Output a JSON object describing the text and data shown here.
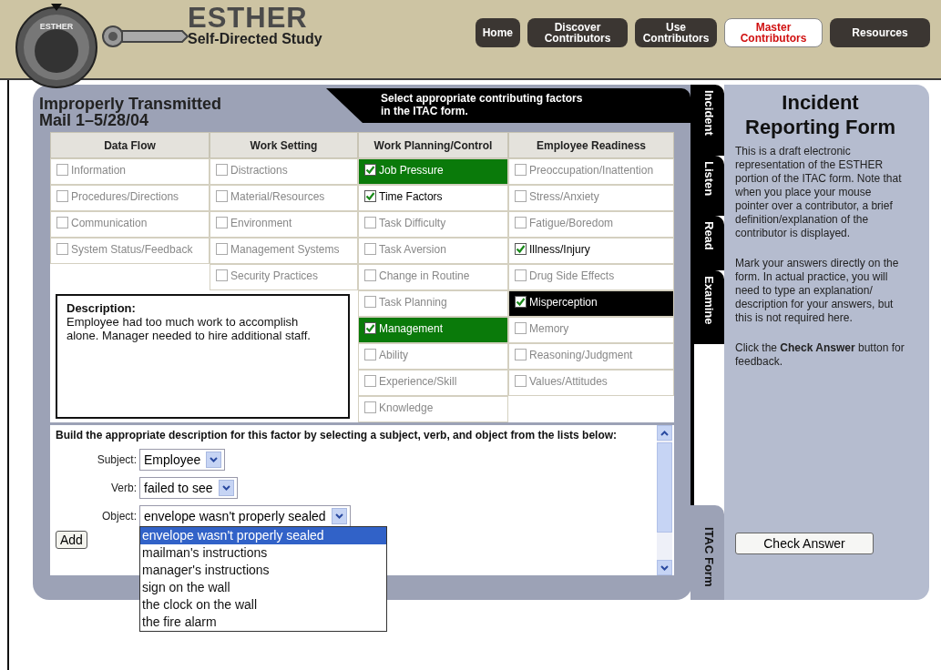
{
  "header": {
    "dial_label": "ESTHER",
    "title": "ESTHER",
    "subtitle": "Self-Directed Study",
    "nav": [
      {
        "label": "Home",
        "selected": false
      },
      {
        "label": "Discover Contributors",
        "selected": false
      },
      {
        "label": "Use Contributors",
        "selected": false
      },
      {
        "label": "Master Contributors",
        "selected": true
      },
      {
        "label": "Resources",
        "selected": false
      }
    ]
  },
  "exercise": {
    "title": "Improperly Transmitted Mail 1–5/28/04",
    "instruction": "Select appropriate contributing factors in the ITAC form.",
    "table": {
      "columns": [
        {
          "heading": "Data Flow",
          "items": [
            {
              "label": "Information",
              "checked": false
            },
            {
              "label": "Procedures/Directions",
              "checked": false
            },
            {
              "label": "Communication",
              "checked": false
            },
            {
              "label": "System Status/Feedback",
              "checked": false
            }
          ]
        },
        {
          "heading": "Work Setting",
          "items": [
            {
              "label": "Distractions",
              "checked": false
            },
            {
              "label": "Material/Resources",
              "checked": false
            },
            {
              "label": "Environment",
              "checked": false
            },
            {
              "label": "Management Systems",
              "checked": false
            },
            {
              "label": "Security Practices",
              "checked": false
            }
          ]
        },
        {
          "heading": "Work Planning/Control",
          "items": [
            {
              "label": "Job Pressure",
              "checked": true,
              "color": "#0a7a0a"
            },
            {
              "label": "Time Factors",
              "checked": true
            },
            {
              "label": "Task Difficulty",
              "checked": false
            },
            {
              "label": "Task Aversion",
              "checked": false
            },
            {
              "label": "Change in Routine",
              "checked": false
            },
            {
              "label": "Task Planning",
              "checked": false
            },
            {
              "label": "Management",
              "checked": true,
              "color": "#0a7a0a"
            },
            {
              "label": "Ability",
              "checked": false
            },
            {
              "label": "Experience/Skill",
              "checked": false
            },
            {
              "label": "Knowledge",
              "checked": false
            }
          ]
        },
        {
          "heading": "Employee Readiness",
          "items": [
            {
              "label": "Preoccupation/Inattention",
              "checked": false
            },
            {
              "label": "Stress/Anxiety",
              "checked": false
            },
            {
              "label": "Fatigue/Boredom",
              "checked": false
            },
            {
              "label": "Illness/Injury",
              "checked": true
            },
            {
              "label": "Drug Side Effects",
              "checked": false
            },
            {
              "label": "Misperception",
              "checked": true,
              "color": "#000000"
            },
            {
              "label": "Memory",
              "checked": false
            },
            {
              "label": "Reasoning/Judgment",
              "checked": false
            },
            {
              "label": "Values/Attitudes",
              "checked": false
            }
          ]
        }
      ]
    },
    "description": {
      "heading": "Description:",
      "text": "Employee had too much work to accomplish alone. Manager needed to hire additional staff."
    },
    "builder": {
      "instruction": "Build the appropriate description for this factor by selecting a subject, verb, and object from the lists below:",
      "fields": [
        {
          "label": "Subject:",
          "value": "Employee"
        },
        {
          "label": "Verb:",
          "value": "failed to see"
        },
        {
          "label": "Object:",
          "value": "envelope wasn't properly sealed",
          "options": [
            {
              "label": "envelope wasn't properly sealed",
              "selected": true
            },
            {
              "label": "mailman's instructions",
              "selected": false
            },
            {
              "label": "manager's instructions",
              "selected": false
            },
            {
              "label": "sign on the wall",
              "selected": false
            },
            {
              "label": "the clock on the wall",
              "selected": false
            },
            {
              "label": "the fire alarm",
              "selected": false
            }
          ]
        }
      ],
      "add_button": "Add"
    }
  },
  "side_tabs": [
    {
      "label": "Incident",
      "selected": false
    },
    {
      "label": "Listen",
      "selected": false
    },
    {
      "label": "Read",
      "selected": false
    },
    {
      "label": "Examine",
      "selected": false
    },
    {
      "label": "ITAC Form",
      "selected": true
    }
  ],
  "info": {
    "title": "Incident Reporting Form",
    "paragraphs": [
      "This is a draft electronic representation of the ESTHER portion of the ITAC form. Note that when you place your mouse pointer over a contributor, a brief definition/explanation of the contributor is displayed.",
      "Mark your answers directly on the form. In actual practice, you will need to type an explanation/ description for your answers, but this is not required here.",
      "Click the **Check Answer** button for feedback."
    ],
    "button": "Check Answer"
  }
}
